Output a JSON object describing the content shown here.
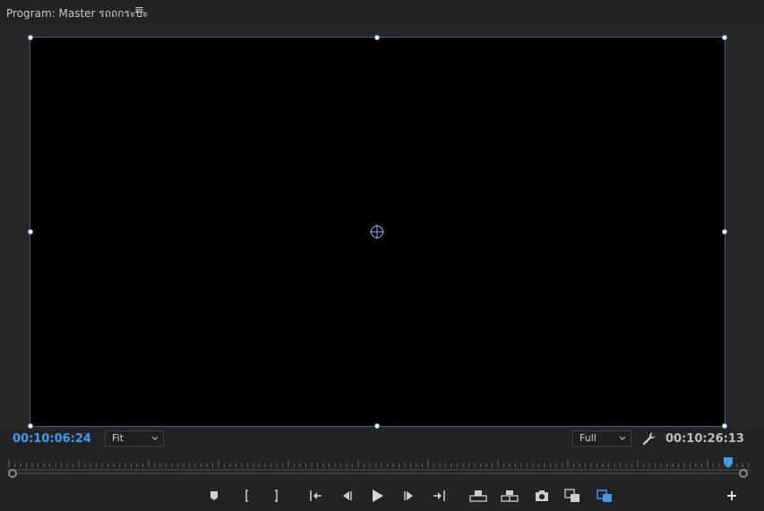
{
  "panel": {
    "title": "Program: Master รถถกระบะ",
    "menu_icon": "hamburger-menu-icon"
  },
  "timecode": {
    "current": "00:10:06:24",
    "duration": "00:10:26:13"
  },
  "zoom_select": {
    "value": "Fit"
  },
  "resolution_select": {
    "value": "Full"
  },
  "playback": {
    "playhead_fraction": 0.97
  },
  "colors": {
    "accent_blue": "#3a9bef",
    "background": "#232323",
    "video": "#000000"
  },
  "transport_icons": [
    "add-marker-icon",
    "mark-in-icon",
    "mark-out-icon",
    "go-to-in-icon",
    "step-back-icon",
    "play-icon",
    "step-forward-icon",
    "go-to-out-icon",
    "lift-icon",
    "extract-icon",
    "export-frame-icon",
    "comparison-view-icon",
    "toggle-proxies-icon",
    "button-editor-plus-icon"
  ]
}
